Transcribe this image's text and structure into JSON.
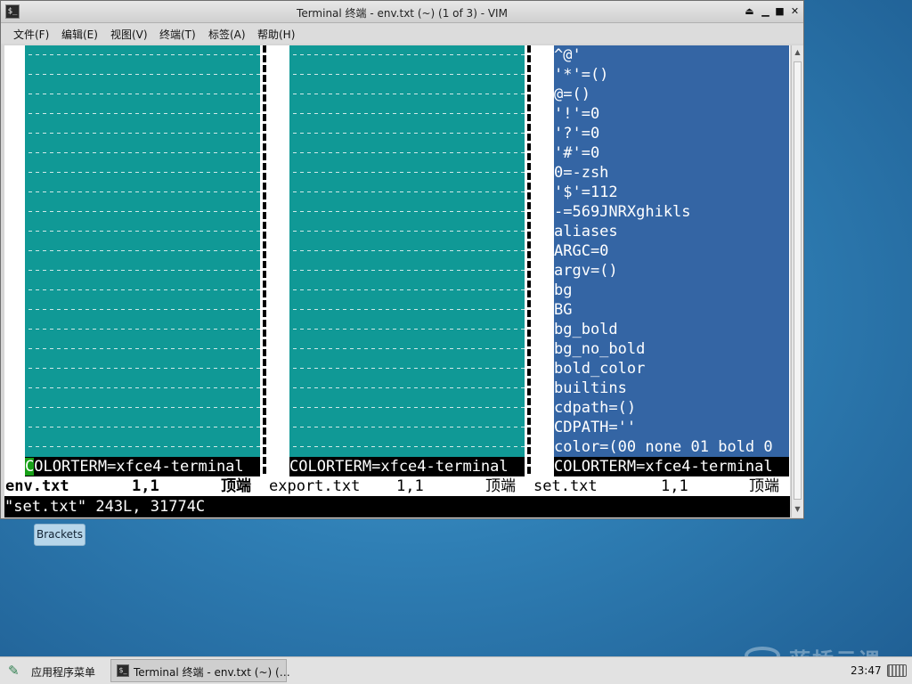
{
  "window": {
    "title": "Terminal 终端 - env.txt (~) (1 of 3) - VIM",
    "controls": [
      "⏏",
      "▁",
      "■",
      "✕"
    ]
  },
  "menubar": [
    {
      "label": "文件(F)"
    },
    {
      "label": "编辑(E)"
    },
    {
      "label": "视图(V)"
    },
    {
      "label": "终端(T)"
    },
    {
      "label": "标签(A)"
    },
    {
      "label": "帮助(H)"
    }
  ],
  "panes": [
    {
      "file": "env.txt",
      "cursor_line": "COLORTERM=xfce4-terminal",
      "pos": "1,1",
      "scroll": "顶端"
    },
    {
      "file": "export.txt",
      "cursor_line": "COLORTERM=xfce4-terminal",
      "pos": "1,1",
      "scroll": "顶端"
    },
    {
      "file": "set.txt",
      "cursor_line": "COLORTERM=xfce4-terminal",
      "pos": "1,1",
      "scroll": "顶端"
    }
  ],
  "set_lines": [
    "^@'",
    "'*'=()",
    "@=()",
    "'!'=0",
    "'?'=0",
    "'#'=0",
    "0=-zsh",
    "'$'=112",
    "-=569JNRXghikls",
    "aliases",
    "ARGC=0",
    "argv=()",
    "bg",
    "BG",
    "bg_bold",
    "bg_no_bold",
    "bold_color",
    "builtins",
    "cdpath=()",
    "CDPATH=''",
    "color=(00 none 01 bold 0"
  ],
  "cmdline": "\"set.txt\" 243L, 31774C",
  "desktop": {
    "brackets_label": "Brackets"
  },
  "watermark": "蓝桥云课",
  "taskbar": {
    "start_label": "应用程序菜单",
    "task_label": "Terminal 终端 - env.txt (~) (…",
    "clock": "23:47"
  }
}
